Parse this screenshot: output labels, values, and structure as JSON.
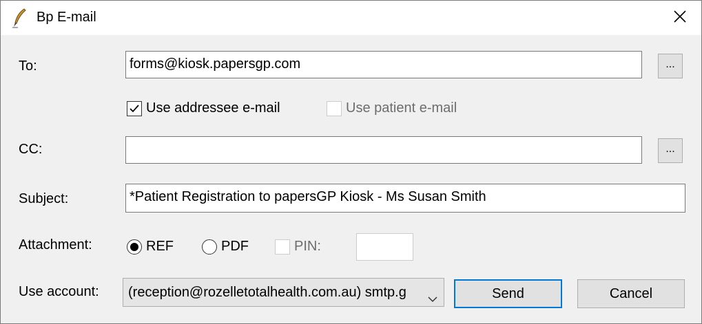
{
  "window": {
    "title": "Bp E-mail",
    "icon": "quill-pen-icon",
    "close_glyph": "✕"
  },
  "form": {
    "to": {
      "label": "To:",
      "value": "forms@kiosk.papersgp.com",
      "browse_label": "..."
    },
    "options": {
      "use_addressee": {
        "label": "Use addressee e-mail",
        "checked": true
      },
      "use_patient": {
        "label": "Use patient e-mail",
        "checked": false,
        "enabled": false
      }
    },
    "cc": {
      "label": "CC:",
      "value": "",
      "browse_label": "..."
    },
    "subject": {
      "label": "Subject:",
      "value": "*Patient Registration to papersGP Kiosk - Ms Susan Smith"
    },
    "attachment": {
      "label": "Attachment:",
      "ref_label": "REF",
      "ref_selected": true,
      "pdf_label": "PDF",
      "pdf_selected": false,
      "pin_label": "PIN:",
      "pin_checked": false,
      "pin_value": ""
    },
    "account": {
      "label": "Use account:",
      "selected": "(reception@rozelletotalhealth.com.au) smtp.g"
    }
  },
  "buttons": {
    "send": "Send",
    "cancel": "Cancel"
  },
  "colors": {
    "accent": "#0078d7",
    "window_bg": "#f0f0f0",
    "disabled_text": "#6d6d6d"
  }
}
